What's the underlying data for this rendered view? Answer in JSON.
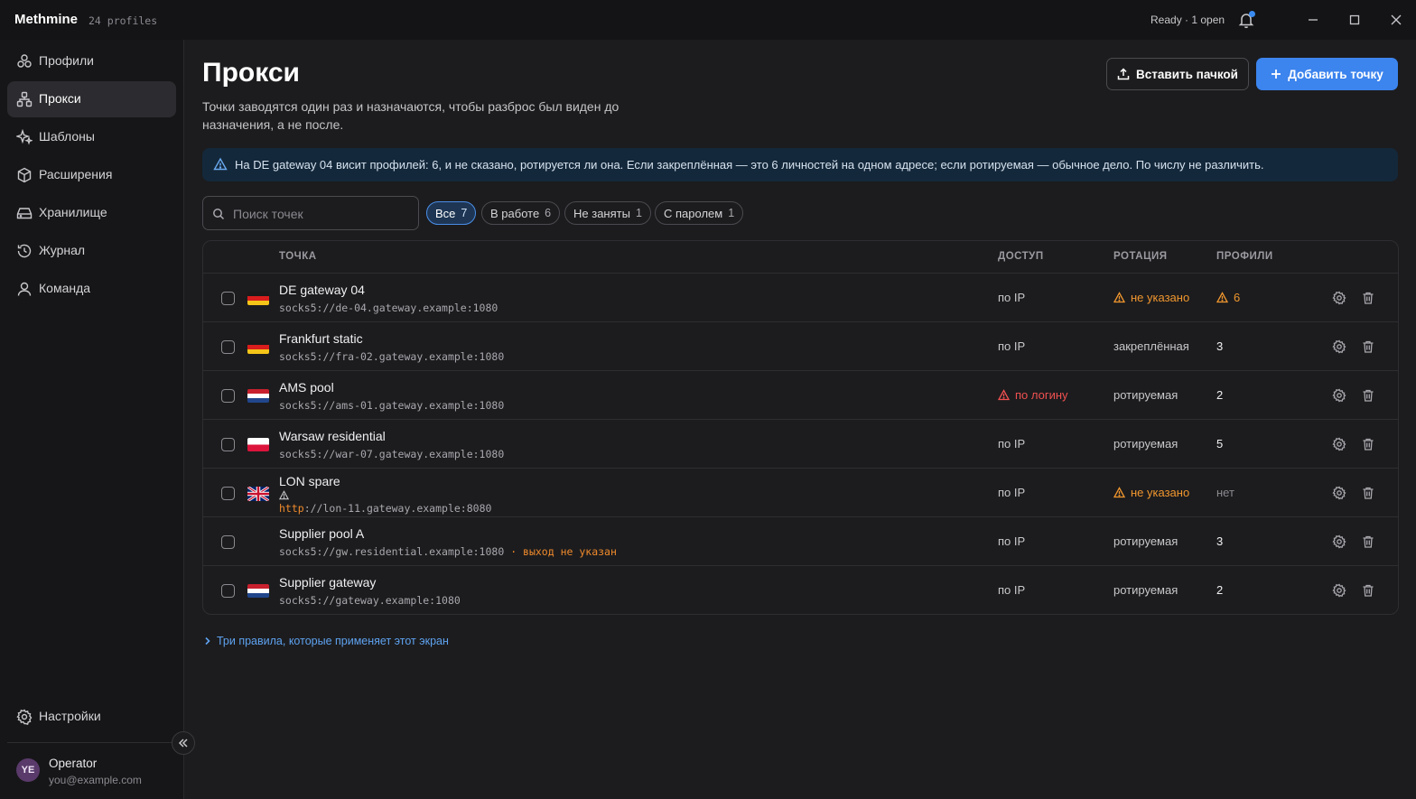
{
  "app": {
    "brand": "Methmine",
    "profiles_count": "24 profiles",
    "status": "Ready · 1 open"
  },
  "sidebar": {
    "items": [
      {
        "label": "Профили",
        "icon": "profiles-icon"
      },
      {
        "label": "Прокси",
        "icon": "proxy-icon",
        "active": true
      },
      {
        "label": "Шаблоны",
        "icon": "templates-icon"
      },
      {
        "label": "Расширения",
        "icon": "extensions-icon"
      },
      {
        "label": "Хранилище",
        "icon": "storage-icon"
      },
      {
        "label": "Журнал",
        "icon": "history-icon"
      },
      {
        "label": "Команда",
        "icon": "team-icon"
      }
    ],
    "settings_label": "Настройки",
    "user": {
      "initials": "YE",
      "name": "Operator",
      "email": "you@example.com"
    }
  },
  "main": {
    "title": "Прокси",
    "description": "Точки заводятся один раз и назначаются, чтобы разброс был виден до назначения, а не после.",
    "paste_batch_label": "Вставить пачкой",
    "add_point_label": "Добавить точку",
    "banner": "На DE gateway 04 висит профилей: 6, и не сказано, ротируется ли она. Если закреплённая — это 6 личностей на одном адресе; если ротируемая — обычное дело. По числу не различить.",
    "search_placeholder": "Поиск точек",
    "filters": [
      {
        "label": "Все",
        "count": "7",
        "active": true
      },
      {
        "label": "В работе",
        "count": "6"
      },
      {
        "label": "Не заняты",
        "count": "1"
      },
      {
        "label": "С паролем",
        "count": "1"
      }
    ],
    "columns": {
      "point": "ТОЧКА",
      "access": "ДОСТУП",
      "rotation": "РОТАЦИЯ",
      "profiles": "ПРОФИЛИ"
    },
    "rows": [
      {
        "name": "DE gateway 04",
        "scheme": "socks5",
        "host": "://de-04.gateway.example:1080",
        "flag": "de",
        "access": "по IP",
        "rotation": "не указано",
        "rotation_warn": true,
        "profiles": "6",
        "profiles_warn": true
      },
      {
        "name": "Frankfurt static",
        "scheme": "socks5",
        "host": "://fra-02.gateway.example:1080",
        "flag": "de",
        "access": "по IP",
        "rotation": "закреплённая",
        "profiles": "3"
      },
      {
        "name": "AMS pool",
        "scheme": "socks5",
        "host": "://ams-01.gateway.example:1080",
        "flag": "nl",
        "access": "по логину",
        "access_warn": true,
        "rotation": "ротируемая",
        "profiles": "2"
      },
      {
        "name": "Warsaw residential",
        "scheme": "socks5",
        "host": "://war-07.gateway.example:1080",
        "flag": "pl",
        "access": "по IP",
        "rotation": "ротируемая",
        "profiles": "5"
      },
      {
        "name": "LON spare",
        "scheme": "http",
        "host": "://lon-11.gateway.example:8080",
        "flag": "gb",
        "access": "по IP",
        "rotation": "не указано",
        "rotation_warn": true,
        "profiles": "нет"
      },
      {
        "name": "Supplier pool A",
        "scheme": "socks5",
        "host": "://gw.residential.example:1080",
        "note": " · выход не указан",
        "flag": "",
        "access": "по IP",
        "rotation": "ротируемая",
        "profiles": "3"
      },
      {
        "name": "Supplier gateway",
        "scheme": "socks5",
        "host": "://gateway.example:1080",
        "flag": "nl",
        "access": "по IP",
        "rotation": "ротируемая",
        "profiles": "2"
      }
    ],
    "rules_link": "Три правила, которые применяет этот экран"
  },
  "colors": {
    "accent": "#3c84ee",
    "warning": "#f0962e",
    "danger": "#f05050",
    "banner_bg": "#14283b"
  }
}
